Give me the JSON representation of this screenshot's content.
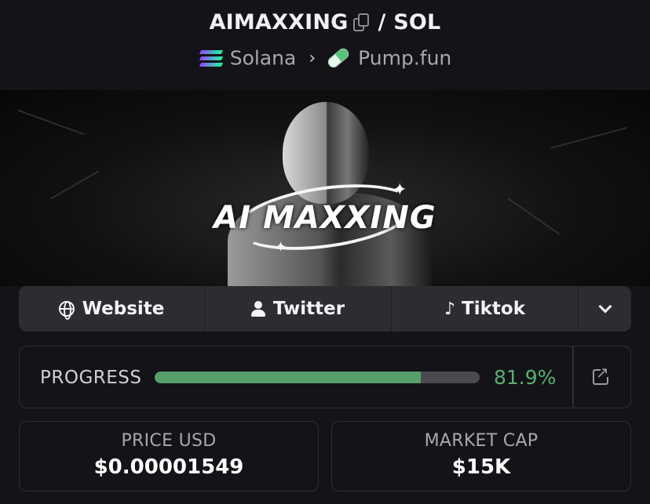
{
  "header": {
    "token_symbol": "AIMAXXING",
    "separator": "/",
    "quote_symbol": "SOL",
    "chain_name": "Solana",
    "breadcrumb_separator": "›",
    "dex_name": "Pump.fun"
  },
  "banner": {
    "logo_text": "AI MAXXING"
  },
  "links": {
    "website": "Website",
    "twitter": "Twitter",
    "tiktok": "Tiktok"
  },
  "progress": {
    "label": "PROGRESS",
    "value_text": "81.9%",
    "fraction": 0.819,
    "color": "#57a06a"
  },
  "stats": {
    "price_label": "PRICE USD",
    "price_value": "$0.00001549",
    "market_cap_label": "MARKET CAP",
    "market_cap_value": "$15K"
  },
  "icons": [
    "copy-icon",
    "solana-icon",
    "pill-icon",
    "globe-icon",
    "user-icon",
    "tiktok-icon",
    "chevron-down-icon",
    "external-link-icon"
  ]
}
